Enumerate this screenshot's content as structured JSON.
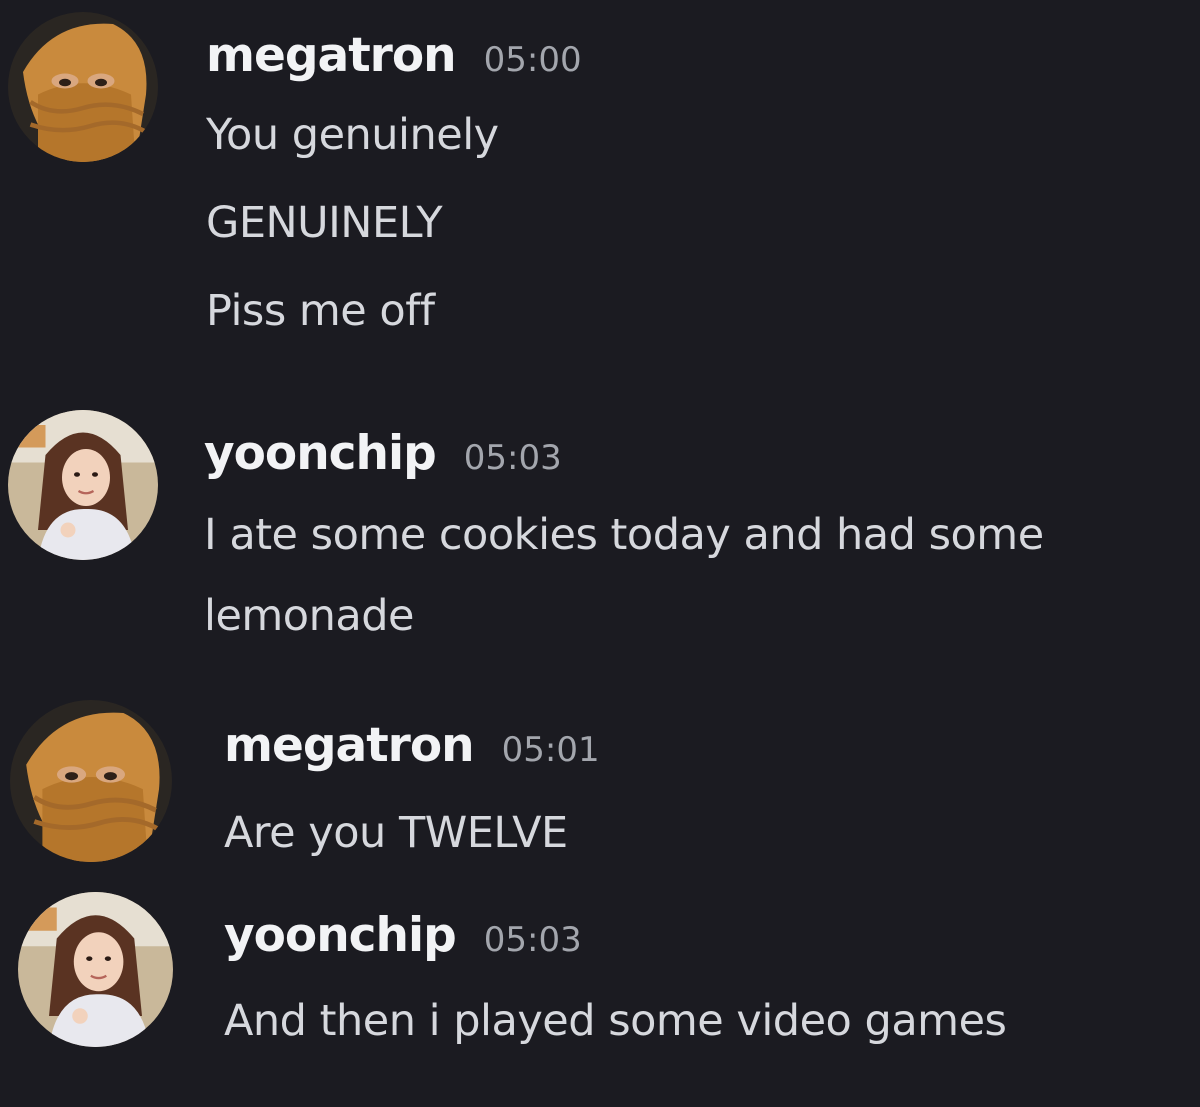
{
  "messages": [
    {
      "author": "megatron",
      "time": "05:00",
      "lines": [
        "You genuinely",
        "GENUINELY",
        "Piss me off"
      ]
    },
    {
      "author": "yoonchip",
      "time": "05:03",
      "lines": [
        "I ate some cookies today and had some",
        "lemonade"
      ]
    },
    {
      "author": "megatron",
      "time": "05:01",
      "lines": [
        "Are you TWELVE"
      ]
    },
    {
      "author": "yoonchip",
      "time": "05:03",
      "lines": [
        "And then i played some video games"
      ]
    }
  ],
  "icons": {
    "megatron_avatar": "user-avatar-megatron",
    "yoonchip_avatar": "user-avatar-yoonchip"
  }
}
